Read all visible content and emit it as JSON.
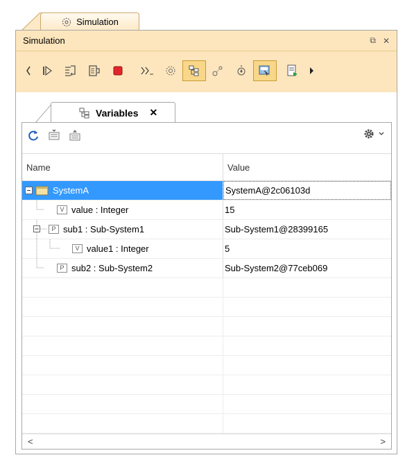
{
  "outer_tab": {
    "label": "Simulation",
    "icon": "simulation-gear-icon"
  },
  "panel": {
    "title": "Simulation",
    "restore_label": "⧉",
    "close_label": "✕"
  },
  "toolbar": {
    "items": [
      {
        "name": "scroll-left-icon"
      },
      {
        "name": "resume-icon"
      },
      {
        "name": "step-into-icon"
      },
      {
        "name": "step-over-icon"
      },
      {
        "name": "terminate-icon"
      },
      {
        "name": "step-out-icon"
      },
      {
        "name": "animation-icon"
      },
      {
        "name": "variables-toggle-icon",
        "active": true
      },
      {
        "name": "breakpoints-icon"
      },
      {
        "name": "triggers-icon"
      },
      {
        "name": "sessions-toggle-icon",
        "active": true
      },
      {
        "name": "export-icon"
      },
      {
        "name": "scroll-right-icon"
      }
    ]
  },
  "variables_tab": {
    "label": "Variables",
    "close": "✕"
  },
  "table": {
    "columns": [
      "Name",
      "Value"
    ],
    "rows": [
      {
        "name": "SystemA",
        "value": "SystemA@2c06103d",
        "badge": "",
        "level": 0,
        "selected": true
      },
      {
        "name": "value : Integer",
        "value": "15",
        "badge": "V",
        "level": 1,
        "selected": false
      },
      {
        "name": "sub1 : Sub-System1",
        "value": "Sub-System1@28399165",
        "badge": "P",
        "level": 1,
        "selected": false
      },
      {
        "name": "value1 : Integer",
        "value": "5",
        "badge": "V",
        "level": 2,
        "selected": false
      },
      {
        "name": "sub2 : Sub-System2",
        "value": "Sub-System2@77ceb069",
        "badge": "P",
        "level": 1,
        "selected": false
      }
    ],
    "empty_rows": 8
  },
  "scroll": {
    "left": "<",
    "right": ">"
  },
  "colors": {
    "band": "#fde6bd",
    "selection": "#3399ff",
    "active_toggle": "#f9d789"
  }
}
